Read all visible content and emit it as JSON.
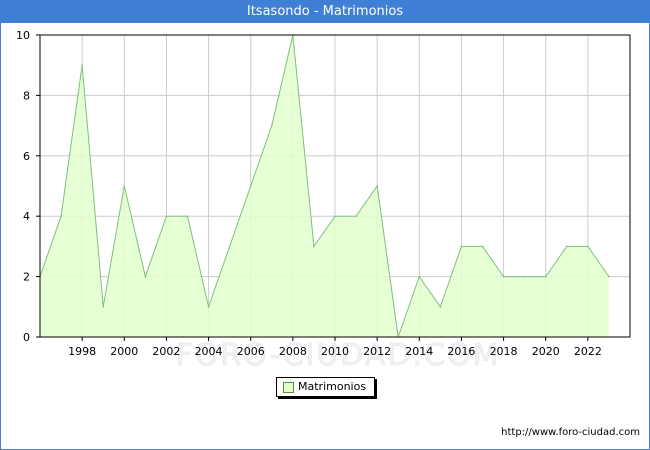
{
  "chart_data": {
    "type": "area",
    "title": "Itsasondo - Matrimonios",
    "x": [
      1996,
      1997,
      1998,
      1999,
      2000,
      2001,
      2002,
      2003,
      2004,
      2005,
      2006,
      2007,
      2008,
      2009,
      2010,
      2011,
      2012,
      2013,
      2014,
      2015,
      2016,
      2017,
      2018,
      2019,
      2020,
      2021,
      2022,
      2023
    ],
    "series": [
      {
        "name": "Matrimonios",
        "values": [
          2,
          4,
          9,
          1,
          5,
          2,
          4,
          4,
          1,
          3,
          5,
          7,
          10,
          3,
          4,
          4,
          5,
          0,
          2,
          1,
          3,
          3,
          2,
          2,
          2,
          3,
          3,
          2
        ]
      }
    ],
    "x_ticks": [
      "1998",
      "2000",
      "2002",
      "2004",
      "2006",
      "2008",
      "2010",
      "2012",
      "2014",
      "2016",
      "2018",
      "2020",
      "2022"
    ],
    "y_ticks": [
      "0",
      "2",
      "4",
      "6",
      "8",
      "10"
    ],
    "xlim": [
      1996,
      2024
    ],
    "ylim": [
      0,
      10
    ],
    "grid": true,
    "legend_position": "bottom-center",
    "colors": {
      "fill": "#e2ffcc",
      "line": "#7fbf7f",
      "grid": "#cccccc",
      "title_bg": "#3f7fd6"
    }
  },
  "watermark": "FORO-CIUDAD.COM",
  "footer_url": "http://www.foro-ciudad.com"
}
